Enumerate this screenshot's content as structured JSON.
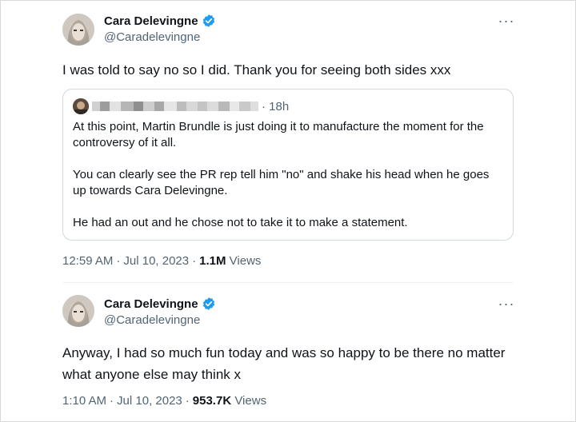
{
  "tweets": [
    {
      "author": {
        "name": "Cara Delevingne",
        "handle": "@Caradelevingne"
      },
      "text": "I was told to say no so I did. Thank you for seeing both sides xxx",
      "quote": {
        "time": "· 18h",
        "paragraphs": [
          "At this point, Martin Brundle is just doing it to manufacture the moment for the controversy of it all.",
          "You can clearly see the PR rep tell him \"no\" and shake his head when he goes up towards Cara Delevingne.",
          "He had an out and he chose not to take it to make a statement."
        ]
      },
      "meta": {
        "time": "12:59 AM",
        "sep1": "·",
        "date": "Jul 10, 2023",
        "sep2": "·",
        "views_count": "1.1M",
        "views_label": "Views"
      }
    },
    {
      "author": {
        "name": "Cara Delevingne",
        "handle": "@Caradelevingne"
      },
      "text": "Anyway, I had so much fun today and was so happy to be there no matter what anyone else may think x",
      "meta": {
        "time": "1:10 AM",
        "sep1": "·",
        "date": "Jul 10, 2023",
        "sep2": "·",
        "views_count": "953.7K",
        "views_label": "Views"
      }
    }
  ],
  "icons": {
    "more": "more-horizontal-icon",
    "verified": "verified-badge-icon"
  },
  "colors": {
    "verified": "#1d9bf0",
    "secondary_text": "#536471",
    "border": "#cfd9de"
  }
}
